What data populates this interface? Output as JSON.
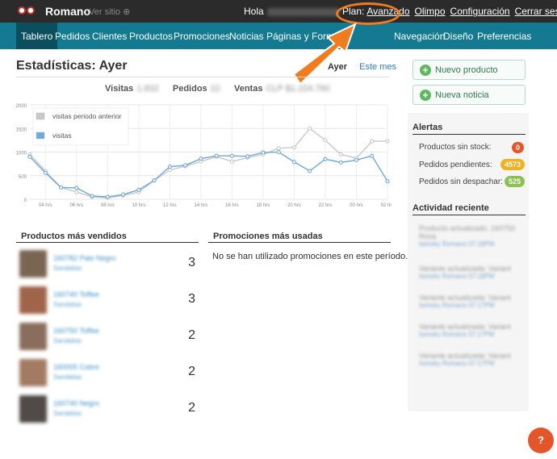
{
  "topbar": {
    "brand": "Romano",
    "view_site": "Ver sitio ⊕",
    "greeting": "Hola",
    "plan_label": "Plan:",
    "plan_value": "Avanzado",
    "links": [
      "Olimpo",
      "Configuración",
      "Cerrar sesión"
    ]
  },
  "nav": {
    "left": [
      "Tablero",
      "Pedidos",
      "Clientes",
      "Productos",
      "Promociones",
      "Noticias",
      "Páginas y Formu"
    ],
    "right": [
      "Navegación",
      "Diseño",
      "Preferencias"
    ],
    "active": "Tablero"
  },
  "stats": {
    "title": "Estadísticas: Ayer",
    "tabs": [
      "Ayer",
      "Este mes"
    ],
    "summary": [
      {
        "label": "Visitas",
        "value": "1.832"
      },
      {
        "label": "Pedidos",
        "value": "22"
      },
      {
        "label": "Ventas",
        "value": "CLP $1.224.760"
      }
    ]
  },
  "chart_data": {
    "type": "line",
    "x": [
      "03 hrs",
      "04 hrs",
      "05 hrs",
      "06 hrs",
      "07 hrs",
      "08 hrs",
      "09 hrs",
      "10 hrs",
      "11 hrs",
      "12 hrs",
      "13 hrs",
      "14 hrs",
      "15 hrs",
      "16 hrs",
      "17 hrs",
      "18 hrs",
      "19 hrs",
      "20 hrs",
      "21 hrs",
      "22 hrs",
      "23 hrs",
      "00 hrs",
      "01 hrs",
      "02 hrs"
    ],
    "x_tick_labels": [
      "04 hrs",
      "06 hrs",
      "08 hrs",
      "10 hrs",
      "12 hrs",
      "14 hrs",
      "16 hrs",
      "18 hrs",
      "20 hrs",
      "22 hrs",
      "00 hrs",
      "02 hrs"
    ],
    "ylim": [
      0,
      2000
    ],
    "y_ticks": [
      0,
      500,
      1000,
      1500,
      2000
    ],
    "grid": true,
    "legend": "top-left",
    "series": [
      {
        "name": "visitas periodo anterior",
        "color": "#c8c8c8",
        "values": [
          950,
          600,
          250,
          150,
          50,
          30,
          80,
          150,
          400,
          620,
          700,
          800,
          900,
          800,
          880,
          950,
          1080,
          1100,
          1500,
          1250,
          950,
          870,
          1230,
          1230
        ]
      },
      {
        "name": "visitas",
        "color": "#6fa8dc",
        "values": [
          900,
          560,
          250,
          240,
          70,
          50,
          100,
          200,
          400,
          690,
          720,
          860,
          920,
          920,
          910,
          990,
          1000,
          790,
          600,
          850,
          780,
          830,
          920,
          380
        ]
      }
    ]
  },
  "top_products": {
    "title": "Productos más vendidos",
    "items": [
      {
        "name": "160782 Palo Negro",
        "sub": "Sandalias",
        "count": "3",
        "thumb": "#7a6452"
      },
      {
        "name": "160740 Toffee",
        "sub": "Sandalias",
        "count": "3",
        "thumb": "#a0644a"
      },
      {
        "name": "160750 Toffee",
        "sub": "Sandalias",
        "count": "2",
        "thumb": "#8a6d5c"
      },
      {
        "name": "160005 Cobre",
        "sub": "Sandalias",
        "count": "2",
        "thumb": "#a37b62"
      },
      {
        "name": "160740 Negro",
        "sub": "Sandalias",
        "count": "2",
        "thumb": "#4f4a48"
      }
    ]
  },
  "promotions": {
    "title": "Promociones más usadas",
    "empty": "No se han utilizado promociones en este período."
  },
  "actions": {
    "new_product": "Nuevo producto",
    "new_news": "Nueva noticia"
  },
  "alerts": {
    "title": "Alertas",
    "items": [
      {
        "label": "Productos sin stock:",
        "value": "0",
        "color": "#e4552a"
      },
      {
        "label": "Pedidos pendientes:",
        "value": "4573",
        "color": "#f2b21f"
      },
      {
        "label": "Pedidos sin despachar:",
        "value": "525",
        "color": "#8cc152"
      }
    ]
  },
  "activity": {
    "title": "Actividad reciente",
    "items": [
      {
        "text": "Producto actualizado: 160750 Rosa",
        "meta": "Iwmsky Romano 07:18PM"
      },
      {
        "text": "Variante actualizada: Variant",
        "meta": "Iwmsky Romano 07:18PM"
      },
      {
        "text": "Variante actualizada: Variant",
        "meta": "Iwmsky Romano 07:17PM"
      },
      {
        "text": "Variante actualizada: Variant",
        "meta": "Iwmsky Romano 07:17PM"
      },
      {
        "text": "Variante actualizada: Variant",
        "meta": "Iwmsky Romano 07:17PM"
      }
    ]
  },
  "help": "?"
}
